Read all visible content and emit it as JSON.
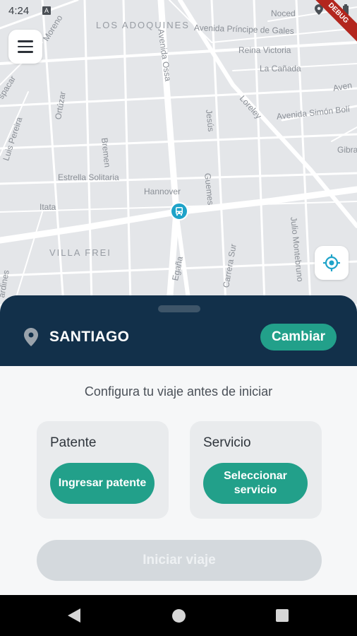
{
  "status_bar": {
    "time": "4:24",
    "notification_badge": "A",
    "debug_banner": "DEBUG"
  },
  "map": {
    "labels": {
      "los_adoquines": "LOS ADOQUINES",
      "villa_frei": "VILLA FREI",
      "av_ossa": "Avenida Ossa",
      "av_principe": "Avenida Príncipe de Gales",
      "reina_victoria": "Reina Victoria",
      "la_canada": "La Cañada",
      "av_simon": "Avenida Simón Bolí",
      "loreley": "Loreley",
      "nocedal": "Noced",
      "moreno": "Moreno",
      "jaspacar": "spacar",
      "luis_pereira": "Luis Pereira",
      "ortuzar": "Ortúzar",
      "bremen": "Bremen",
      "estrella": "Estrella Solitaria",
      "hannover": "Hannover",
      "itata": "Itata",
      "jesus": "Jesús",
      "guemes": "Guemes",
      "egana": "Egaña",
      "julio_montebruno": "Julio Montebruno",
      "carrera_sur": "Carrera Sur",
      "gibra": "Gibra",
      "aven": "Aven",
      "ardines": "ardines"
    },
    "menu_icon": "menu-icon",
    "locate_icon": "my-location-icon",
    "bus_icon": "bus-stop-icon"
  },
  "header": {
    "city": "SANTIAGO",
    "change_label": "Cambiar"
  },
  "setup": {
    "subtitle": "Configura tu viaje antes de iniciar",
    "plate": {
      "title": "Patente",
      "button": "Ingresar patente"
    },
    "service": {
      "title": "Servicio",
      "button": "Seleccionar servicio"
    },
    "start_label": "Iniciar viaje"
  },
  "colors": {
    "header_bg": "#12304a",
    "accent": "#22a08a",
    "disabled": "#d4d9dd",
    "bus_marker": "#1ea3c9"
  }
}
